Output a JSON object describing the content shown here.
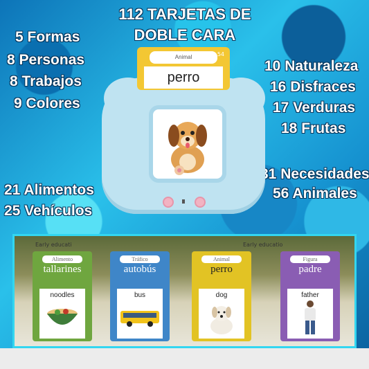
{
  "title_line1": "112 TARJETAS DE",
  "title_line2": "DOBLE CARA",
  "left_labels": [
    "5 Formas",
    "8 Personas",
    "8 Trabajos",
    "9 Colores"
  ],
  "right_labels": [
    "10 Naturaleza",
    "16 Disfraces",
    "17 Verduras",
    "18 Frutas"
  ],
  "lower_left_labels": [
    "21 Alimentos",
    "25 Vehículos"
  ],
  "lower_right_labels": [
    "31 Necesidades",
    "56 Animales"
  ],
  "device_card": {
    "category": "Animal",
    "number": "54",
    "word": "perro"
  },
  "photo_cards": [
    {
      "category": "Alimento",
      "word": "tallarines",
      "english": "noodles",
      "color": "#6fa63f",
      "picture": "noodle-bowl-icon"
    },
    {
      "category": "Tráfico",
      "word": "autobús",
      "english": "bus",
      "color": "#3f86c8",
      "picture": "bus-icon"
    },
    {
      "category": "Animal",
      "word": "perro",
      "english": "dog",
      "color": "#e2c324",
      "picture": "dog-icon"
    },
    {
      "category": "Figura",
      "word": "padre",
      "english": "father",
      "color": "#8a5db3",
      "picture": "man-icon"
    }
  ],
  "box_text": [
    "Early educati",
    "Early educatio"
  ]
}
